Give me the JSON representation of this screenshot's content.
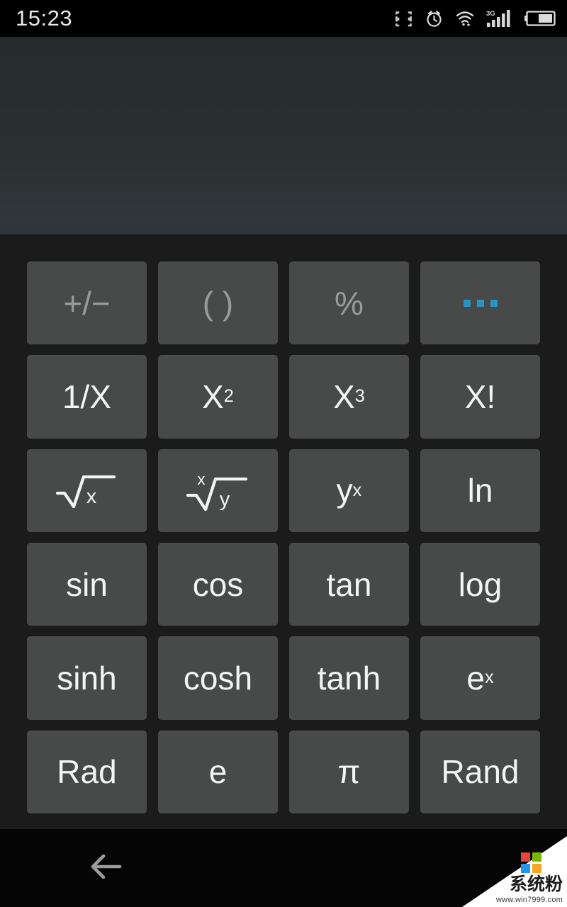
{
  "status_bar": {
    "time": "15:23",
    "icons": [
      {
        "name": "qr-scan-icon",
        "label": "scan"
      },
      {
        "name": "alarm-clock-icon",
        "label": "alarm"
      },
      {
        "name": "wifi-icon",
        "label": "wifi"
      },
      {
        "name": "signal-3g-icon",
        "label": "3G"
      },
      {
        "name": "battery-icon",
        "label": "battery"
      }
    ],
    "network_label": "3G"
  },
  "display": {
    "value": "",
    "placeholder": ""
  },
  "keypad": {
    "rows": [
      [
        {
          "name": "plus-minus",
          "label": "+/−",
          "style": "dim",
          "kind": "text"
        },
        {
          "name": "parentheses",
          "label": "( )",
          "style": "dim",
          "kind": "text"
        },
        {
          "name": "percent",
          "label": "%",
          "style": "dim",
          "kind": "text"
        },
        {
          "name": "more-options",
          "label": "•••",
          "style": "accent",
          "kind": "dots"
        }
      ],
      [
        {
          "name": "reciprocal",
          "label": "1/X",
          "style": "normal",
          "kind": "text"
        },
        {
          "name": "square",
          "label": "X",
          "sup": "2",
          "style": "normal",
          "kind": "sup"
        },
        {
          "name": "cube",
          "label": "X",
          "sup": "3",
          "style": "normal",
          "kind": "sup"
        },
        {
          "name": "factorial",
          "label": "X!",
          "style": "normal",
          "kind": "text"
        }
      ],
      [
        {
          "name": "square-root",
          "label": "√x",
          "radicand": "x",
          "style": "normal",
          "kind": "sqrt"
        },
        {
          "name": "nth-root",
          "label": "ˣ√y",
          "index": "x",
          "radicand": "y",
          "style": "normal",
          "kind": "nthroot"
        },
        {
          "name": "power-y-x",
          "label": "y",
          "sup": "x",
          "style": "normal",
          "kind": "sup"
        },
        {
          "name": "natural-log",
          "label": "ln",
          "style": "normal",
          "kind": "text"
        }
      ],
      [
        {
          "name": "sin",
          "label": "sin",
          "style": "normal",
          "kind": "text"
        },
        {
          "name": "cos",
          "label": "cos",
          "style": "normal",
          "kind": "text"
        },
        {
          "name": "tan",
          "label": "tan",
          "style": "normal",
          "kind": "text"
        },
        {
          "name": "log",
          "label": "log",
          "style": "normal",
          "kind": "text"
        }
      ],
      [
        {
          "name": "sinh",
          "label": "sinh",
          "style": "normal",
          "kind": "text"
        },
        {
          "name": "cosh",
          "label": "cosh",
          "style": "normal",
          "kind": "text"
        },
        {
          "name": "tanh",
          "label": "tanh",
          "style": "normal",
          "kind": "text"
        },
        {
          "name": "exp",
          "label": "e",
          "sup": "x",
          "style": "normal",
          "kind": "sup"
        }
      ],
      [
        {
          "name": "rad-mode",
          "label": "Rad",
          "style": "normal",
          "kind": "text"
        },
        {
          "name": "euler-constant",
          "label": "e",
          "style": "normal",
          "kind": "text"
        },
        {
          "name": "pi-constant",
          "label": "π",
          "style": "normal",
          "kind": "text"
        },
        {
          "name": "random",
          "label": "Rand",
          "style": "normal",
          "kind": "text"
        }
      ]
    ]
  },
  "nav_bar": {
    "back_label": "←"
  },
  "watermark": {
    "brand": "系统粉",
    "url": "www.win7999.com",
    "logo_colors": [
      "#e8453c",
      "#7ab800",
      "#2196f3",
      "#f5a623"
    ]
  },
  "colors": {
    "accent": "#2795c6",
    "key_bg": "#474a48",
    "keypad_bg": "#1b1b1b",
    "display_bg": "#2a2f32",
    "text_primary": "#f4f4f4",
    "text_dim": "#9a9c9a",
    "statusbar_bg": "#000000",
    "navbar_bg": "#050505"
  }
}
